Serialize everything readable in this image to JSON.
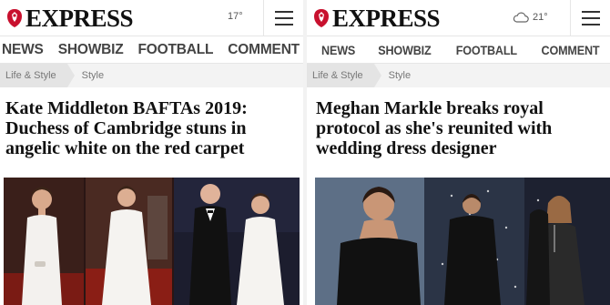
{
  "left": {
    "brand": "EXPRESS",
    "temperature": "17°",
    "nav": [
      "NEWS",
      "SHOWBIZ",
      "FOOTBALL",
      "COMMENT"
    ],
    "breadcrumb": [
      "Life & Style",
      "Style"
    ],
    "headline": "Kate Middleton BAFTAs 2019: Duchess of Cambridge stuns in angelic white on the red carpet"
  },
  "right": {
    "brand": "EXPRESS",
    "temperature": "21°",
    "weather_icon": "cloud-icon",
    "nav": [
      "NEWS",
      "SHOWBIZ",
      "FOOTBALL",
      "COMMENT"
    ],
    "breadcrumb": [
      "Life & Style",
      "Style"
    ],
    "headline": "Meghan Markle breaks royal protocol as she's reunited with wedding dress designer"
  },
  "colors": {
    "brand_red": "#c8102e",
    "text": "#111111",
    "nav_text": "#444444",
    "crumb_bg": "#e4e4e4"
  }
}
